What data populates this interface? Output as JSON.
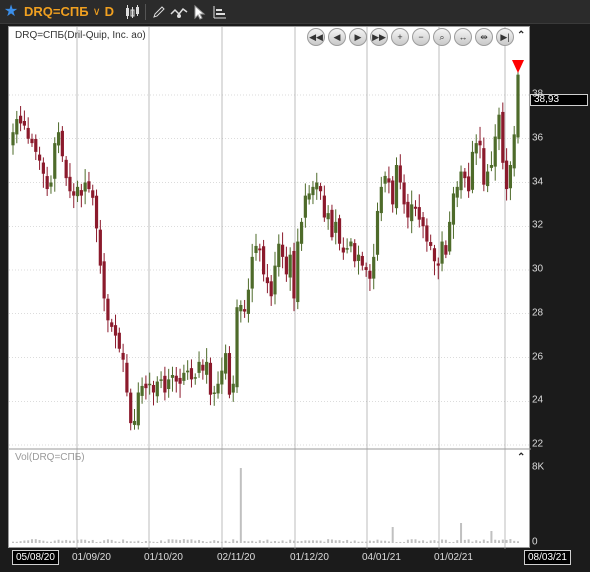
{
  "toolbar": {
    "ric": "DRQ=СПБ",
    "interval": "D",
    "icons": [
      "star-icon",
      "chevron-down-icon",
      "candlestick-icon",
      "pencil-icon",
      "compare-icon",
      "cursor-icon",
      "studies-icon"
    ]
  },
  "panel": {
    "title": "DRQ=СПБ(Dril-Quip, Inc. ao)",
    "volume_title": "Vol(DRQ=СПБ)",
    "nav_icons": [
      "rewind-icon",
      "step-back-icon",
      "play-icon",
      "fast-forward-icon",
      "zoom-in-icon",
      "zoom-out-icon",
      "zoom-fit-icon",
      "expand-icon",
      "compress-icon",
      "end-icon"
    ]
  },
  "axis": {
    "last_price": "38,93",
    "price_ticks": [
      "38",
      "36",
      "34",
      "32",
      "30",
      "28",
      "26",
      "24",
      "22"
    ],
    "volume_ticks": [
      "8K",
      "0"
    ],
    "start_date": "05/08/20",
    "end_date": "08/03/21",
    "date_ticks": [
      "01/09/20",
      "01/10/20",
      "02/11/20",
      "01/12/20",
      "04/01/21",
      "01/02/21"
    ]
  },
  "colors": {
    "up": "#4e6b2a",
    "down": "#8b1a2c",
    "marker": "#ff0000",
    "volume": "#c0c0c0",
    "grid": "#b8b8b8"
  },
  "chart_data": {
    "type": "candlestick",
    "title": "DRQ=СПБ(Dril-Quip, Inc. ao)",
    "ylim": [
      22,
      39
    ],
    "last": 38.93,
    "x_start": "05/08/20",
    "x_end": "08/03/21",
    "close": [
      36.3,
      36.9,
      36.7,
      36.6,
      36.0,
      35.8,
      35.4,
      35.0,
      34.4,
      33.7,
      34.0,
      35.8,
      36.3,
      35.2,
      34.2,
      33.6,
      33.4,
      33.8,
      33.4,
      34.0,
      33.7,
      33.3,
      31.9,
      30.2,
      28.7,
      27.7,
      27.4,
      27.0,
      26.4,
      25.9,
      24.4,
      23.0,
      23.1,
      24.4,
      24.7,
      24.6,
      24.8,
      24.4,
      24.9,
      25.0,
      24.4,
      25.0,
      25.2,
      24.9,
      24.8,
      25.3,
      25.4,
      25.0,
      25.1,
      25.8,
      25.4,
      25.8,
      24.3,
      24.4,
      24.8,
      25.4,
      26.2,
      24.3,
      24.8,
      28.3,
      28.4,
      28.1,
      29.1,
      30.6,
      31.1,
      30.9,
      29.8,
      29.4,
      28.8,
      30.2,
      31.2,
      30.6,
      29.8,
      30.7,
      28.7,
      31.3,
      32.2,
      33.4,
      33.5,
      33.8,
      34.0,
      33.6,
      32.4,
      32.6,
      31.5,
      32.2,
      31.2,
      30.8,
      31.0,
      31.3,
      30.4,
      30.7,
      30.2,
      30.0,
      29.6,
      30.6,
      32.7,
      33.8,
      34.3,
      34.0,
      33.0,
      34.8,
      34.0,
      33.0,
      32.4,
      33.0,
      32.8,
      32.3,
      32.0,
      31.3,
      31.1,
      30.4,
      30.2,
      31.3,
      30.7,
      32.2,
      33.5,
      33.8,
      34.5,
      34.2,
      33.6,
      35.4,
      35.8,
      35.7,
      33.9,
      34.5,
      34.8,
      36.1,
      37.1,
      34.9,
      33.7,
      34.8,
      36.2,
      38.93
    ]
  }
}
